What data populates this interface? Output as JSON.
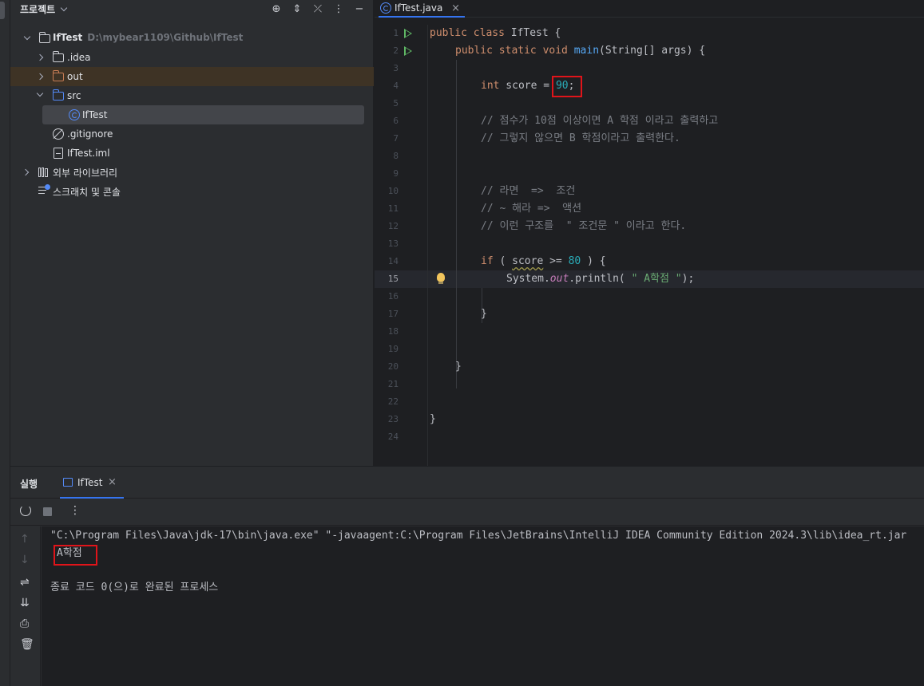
{
  "project_panel": {
    "title": "프로젝트",
    "header_icons": [
      "crosshair-icon",
      "expand-icon",
      "collapse-icon",
      "more-icon",
      "minimize-icon"
    ],
    "tree": [
      {
        "label": "IfTest",
        "path": "D:\\mybear1109\\Github\\IfTest",
        "type": "module",
        "expanded": true
      },
      {
        "label": ".idea",
        "type": "folder",
        "expanded": false
      },
      {
        "label": "out",
        "type": "folder-excluded",
        "expanded": false
      },
      {
        "label": "src",
        "type": "source-folder",
        "expanded": true
      },
      {
        "label": "IfTest",
        "type": "class",
        "selected": true
      },
      {
        "label": ".gitignore",
        "type": "ignore-file"
      },
      {
        "label": "IfTest.iml",
        "type": "iml-file"
      },
      {
        "label": "외부 라이브러리",
        "type": "libraries",
        "expanded": false
      },
      {
        "label": "스크래치 및 콘솔",
        "type": "scratches"
      }
    ]
  },
  "editor": {
    "tab_label": "IfTest.java",
    "current_line": 15,
    "line_numbers": [
      "1",
      "2",
      "3",
      "4",
      "5",
      "6",
      "7",
      "8",
      "9",
      "10",
      "11",
      "12",
      "13",
      "14",
      "15",
      "16",
      "17",
      "18",
      "19",
      "20",
      "21",
      "22",
      "23",
      "24"
    ],
    "code": {
      "l1_kw": "public class",
      "l1_rest": " IfTest {",
      "l2_kw": "public static void",
      "l2_fn": "main",
      "l2_rest": "(String[] args) {",
      "l4_kw": "int",
      "l4_mid": " score = ",
      "l4_num": "90",
      "l4_end": ";",
      "l6": "// 점수가 10점 이상이면 A 학점 이라고 출력하고",
      "l7": "// 그렇지 않으면 B 학점이라고 출력한다.",
      "l10": "// 라면  =>  조건",
      "l11": "// ~ 해라 =>  액션",
      "l12": "// 이런 구조를  \" 조건문 \" 이라고 한다.",
      "l14_kw": "if",
      "l14_a": " ( ",
      "l14_var": "score",
      "l14_b": " >= ",
      "l14_num": "80",
      "l14_c": " ) {",
      "l15_a": "System.",
      "l15_fld": "out",
      "l15_b": ".println( ",
      "l15_str": "\" A학점 \"",
      "l15_c": ");",
      "l17": "}",
      "l20": "}",
      "l23": "}"
    }
  },
  "run_panel": {
    "title": "실행",
    "tab_label": "IfTest",
    "console": {
      "command": "\"C:\\Program Files\\Java\\jdk-17\\bin\\java.exe\" \"-javaagent:C:\\Program Files\\JetBrains\\IntelliJ IDEA Community Edition 2024.3\\lib\\idea_rt.jar",
      "output": "A학점",
      "exit": "종료 코드 0(으)로 완료된 프로세스"
    }
  },
  "colors": {
    "keyword": "#cf8e6d",
    "function": "#56a8f5",
    "number": "#2aacb8",
    "comment": "#7a7e85",
    "string": "#6aab73",
    "highlight_box": "#e0141a",
    "accent": "#3574f0"
  }
}
